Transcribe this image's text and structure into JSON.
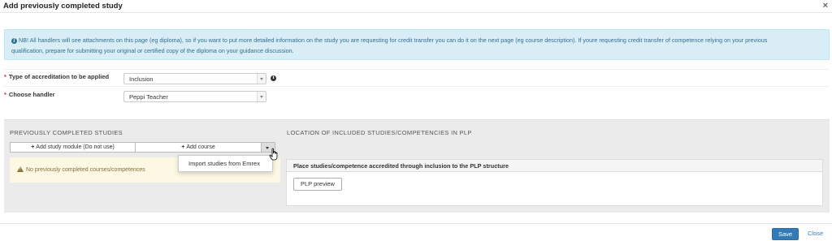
{
  "dialog": {
    "title": "Add previously completed study",
    "close_symbol": "×"
  },
  "info": {
    "icon": "info-icon",
    "text_line1": "NB! All handlers will see attachments on this page (eg diploma), so if you want to put more detailed information on the study you are requesting for credit transfer you can do it on the next page (eg course description). If youre requesting credit transfer of competence relying on your previous",
    "text_line2": "qualification, prepare for submitting your original or certified copy of the diploma on your guidance discussion."
  },
  "form": {
    "required_marker": "*",
    "accreditation_label": "Type of accreditation to be applied",
    "accreditation_value": "Inclusion",
    "handler_label": "Choose handler",
    "handler_value": "Peppi Teacher"
  },
  "left_section": {
    "title": "PREVIOUSLY COMPLETED STUDIES",
    "add_module_label": "Add study module (Do not use)",
    "add_course_label": "Add course",
    "warning_text": "No previously completed courses/competences",
    "dropdown_item": "Import studies from Emrex"
  },
  "right_section": {
    "title": "LOCATION OF INCLUDED STUDIES/COMPETENCIES IN PLP",
    "box_header": "Place studies/competence accredited through inclusion to the PLP structure",
    "preview_button": "PLP preview"
  },
  "footer": {
    "save_label": "Save",
    "close_label": "Close"
  },
  "colors": {
    "info_bg": "#d9edf7",
    "warning_bg": "#fcf8e3",
    "primary": "#337ab7",
    "required": "#c9302c"
  }
}
